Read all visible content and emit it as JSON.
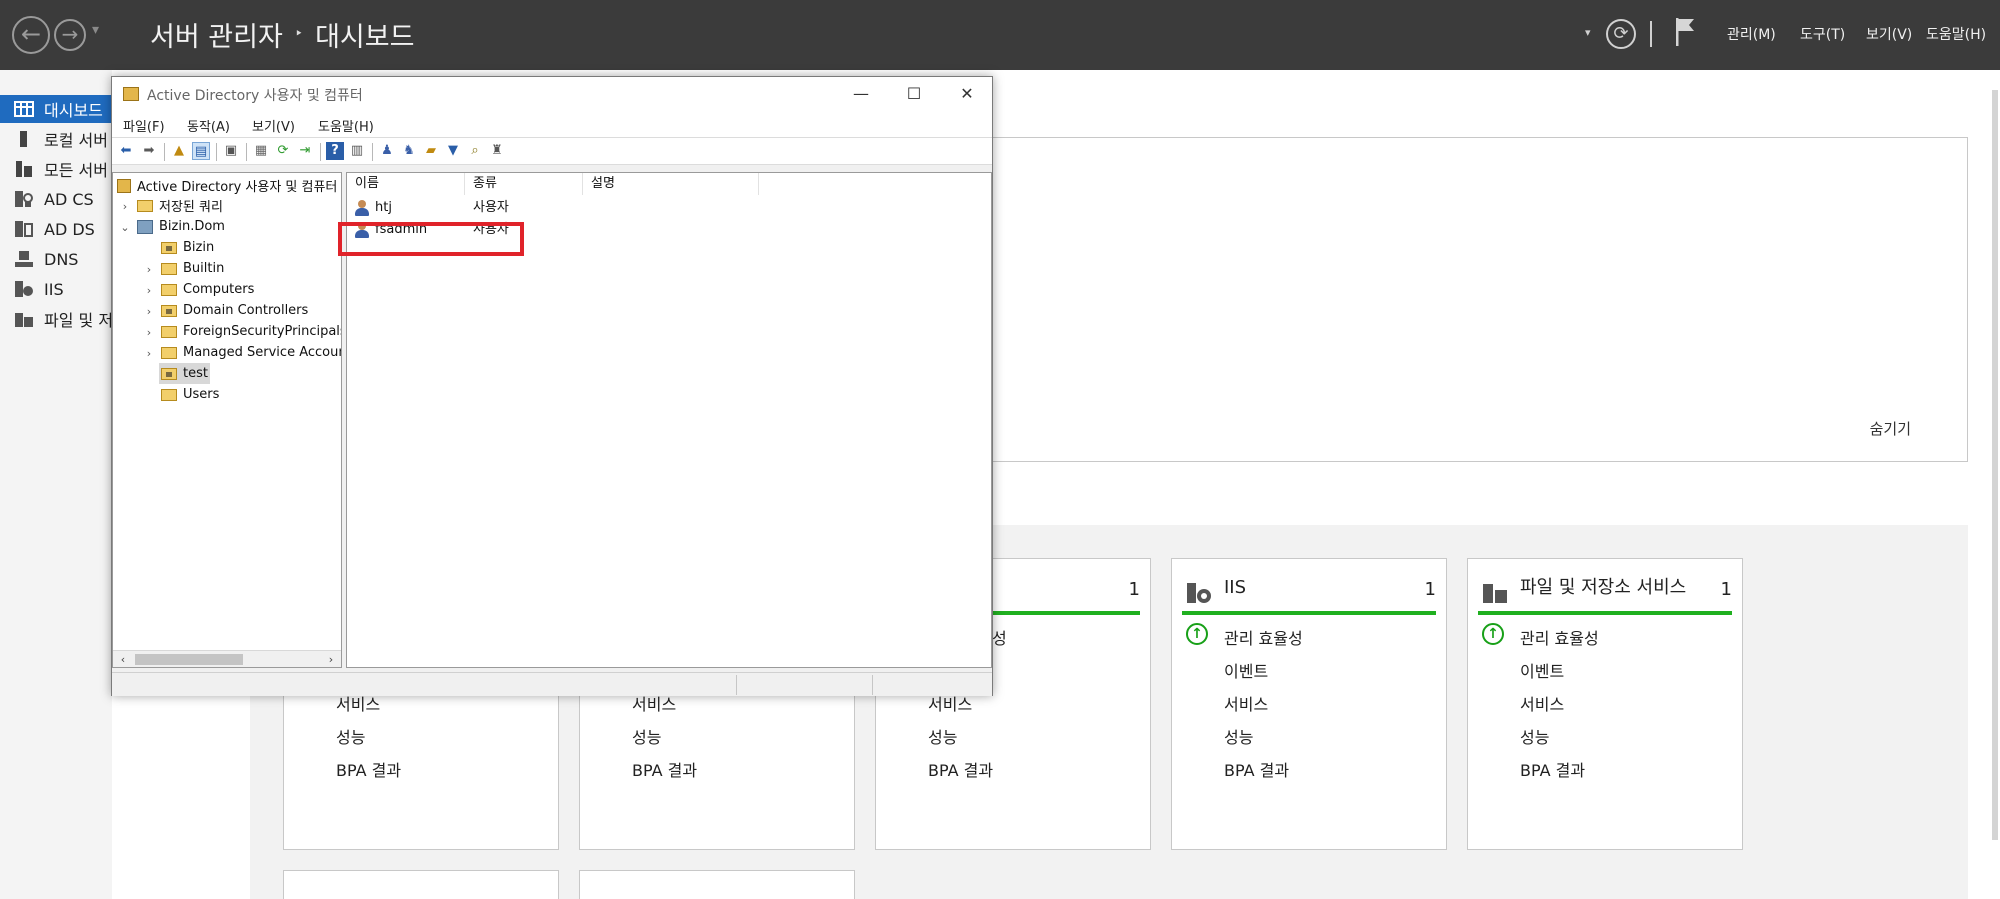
{
  "header": {
    "title": "서버 관리자",
    "separator": "‣",
    "page": "대시보드",
    "menus": [
      "관리(M)",
      "도구(T)",
      "보기(V)",
      "도움말(H)"
    ]
  },
  "sidebar": {
    "items": [
      {
        "label": "대시보드",
        "icon": "dashboard-icon",
        "active": true
      },
      {
        "label": "로컬 서버",
        "icon": "local-server-icon"
      },
      {
        "label": "모든 서버",
        "icon": "all-servers-icon"
      },
      {
        "label": "AD CS",
        "icon": "ad-cs-icon"
      },
      {
        "label": "AD DS",
        "icon": "ad-ds-icon"
      },
      {
        "label": "DNS",
        "icon": "dns-icon"
      },
      {
        "label": "IIS",
        "icon": "iis-icon"
      },
      {
        "label": "파일 및 저",
        "icon": "file-storage-icon"
      }
    ]
  },
  "welcome": {
    "hide_label": "숨기기"
  },
  "tiles": [
    {
      "title": "",
      "count": "",
      "rows": [
        "",
        "",
        "서비스",
        "성능",
        "BPA 결과"
      ]
    },
    {
      "title": "",
      "count": "",
      "rows": [
        "",
        "",
        "서비스",
        "성능",
        "BPA 결과"
      ]
    },
    {
      "title": "",
      "count": "1",
      "rows": [
        "관리 효율성",
        "",
        "서비스",
        "성능",
        "BPA 결과"
      ]
    },
    {
      "title": "IIS",
      "count": "1",
      "rows": [
        "관리 효율성",
        "이벤트",
        "서비스",
        "성능",
        "BPA 결과"
      ]
    },
    {
      "title": "파일 및 저장소 서비스",
      "count": "1",
      "rows": [
        "관리 효율성",
        "이벤트",
        "서비스",
        "성능",
        "BPA 결과"
      ]
    }
  ],
  "aduc": {
    "title": "Active Directory 사용자 및 컴퓨터",
    "window_buttons": {
      "minimize": "—",
      "maximize": "☐",
      "close": "✕"
    },
    "menu": [
      "파일(F)",
      "동작(A)",
      "보기(V)",
      "도움말(H)"
    ],
    "tree": {
      "root": "Active Directory 사용자 및 컴퓨터",
      "saved_queries": "저장된 쿼리",
      "domain": "Bizin.Dom",
      "children": [
        "Bizin",
        "Builtin",
        "Computers",
        "Domain Controllers",
        "ForeignSecurityPrincipals",
        "Managed Service Accounts",
        "test",
        "Users"
      ],
      "selected": "test"
    },
    "columns": [
      "이름",
      "종류",
      "설명"
    ],
    "rows": [
      {
        "name": "htj",
        "type": "사용자",
        "desc": ""
      },
      {
        "name": "fsadmin",
        "type": "사용자",
        "desc": ""
      }
    ],
    "highlighted_row": "fsadmin"
  },
  "colors": {
    "header_bg": "#3b3b3b",
    "active_nav": "#1f6bbf",
    "status_green": "#20b020",
    "highlight_red": "#e0232a"
  }
}
